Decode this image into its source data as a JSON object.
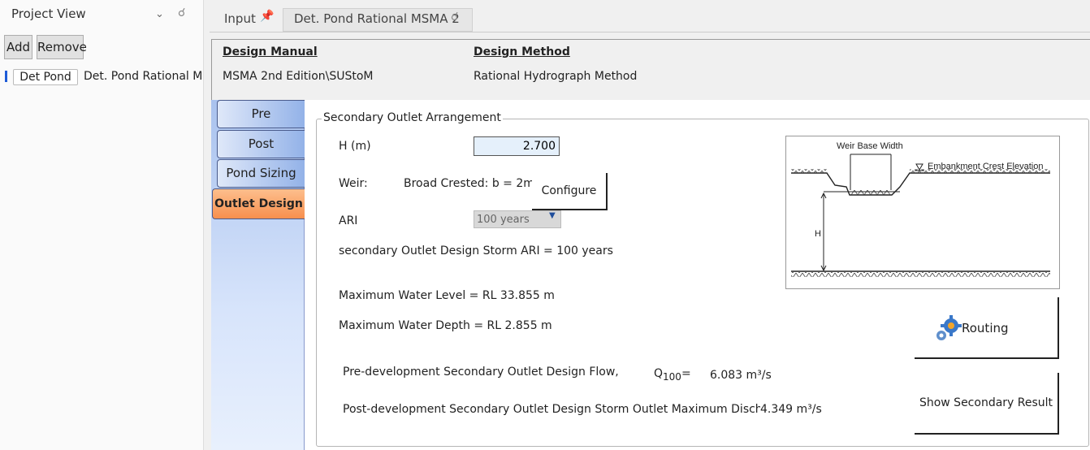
{
  "project_view": {
    "title": "Project View",
    "add_label": "Add",
    "remove_label": "Remove",
    "tree_item": {
      "chip": "Det Pond",
      "label": "Det. Pond Rational MS"
    }
  },
  "tabs": [
    {
      "label": "Input"
    },
    {
      "label": "Det. Pond Rational MSMA 2"
    }
  ],
  "design": {
    "manual_header": "Design Manual",
    "manual_value": "MSMA 2nd Edition\\SUStoM",
    "method_header": "Design Method",
    "method_value": "Rational Hydrograph Method"
  },
  "side_tabs": [
    {
      "label": "Pre"
    },
    {
      "label": "Post"
    },
    {
      "label": "Pond Sizing"
    },
    {
      "label": "Outlet Design"
    }
  ],
  "form": {
    "group_title": "Secondary Outlet Arrangement",
    "h_label": "H (m)",
    "h_value": "2.700",
    "weir_label": "Weir:",
    "weir_desc": "Broad Crested: b = 2m",
    "configure_label": "Configure",
    "ari_label": "ARI",
    "ari_value": "100 years",
    "storm_text": "secondary Outlet Design Storm ARI =  100 years",
    "mwl_text": "Maximum Water Level =  RL 33.855 m",
    "mwd_text": "Maximum Water Depth =  RL 2.855 m",
    "pre_flow_label": "Pre-development Secondary Outlet Design Flow,",
    "q_symbol": "Q",
    "q_sub": "100",
    "q_eq": "=",
    "pre_flow_value": "6.083 m³/s",
    "post_flow_label": "Post-development Secondary Outlet Design Storm Outlet Maximum Discharge",
    "post_flow_value": "4.349 m³/s",
    "routing_label": "Routing",
    "show_label": "Show Secondary Result"
  },
  "diagram": {
    "weir_base_label": "Weir Base Width",
    "crest_label": "Embankment Crest Elevation",
    "h_label": "H"
  }
}
